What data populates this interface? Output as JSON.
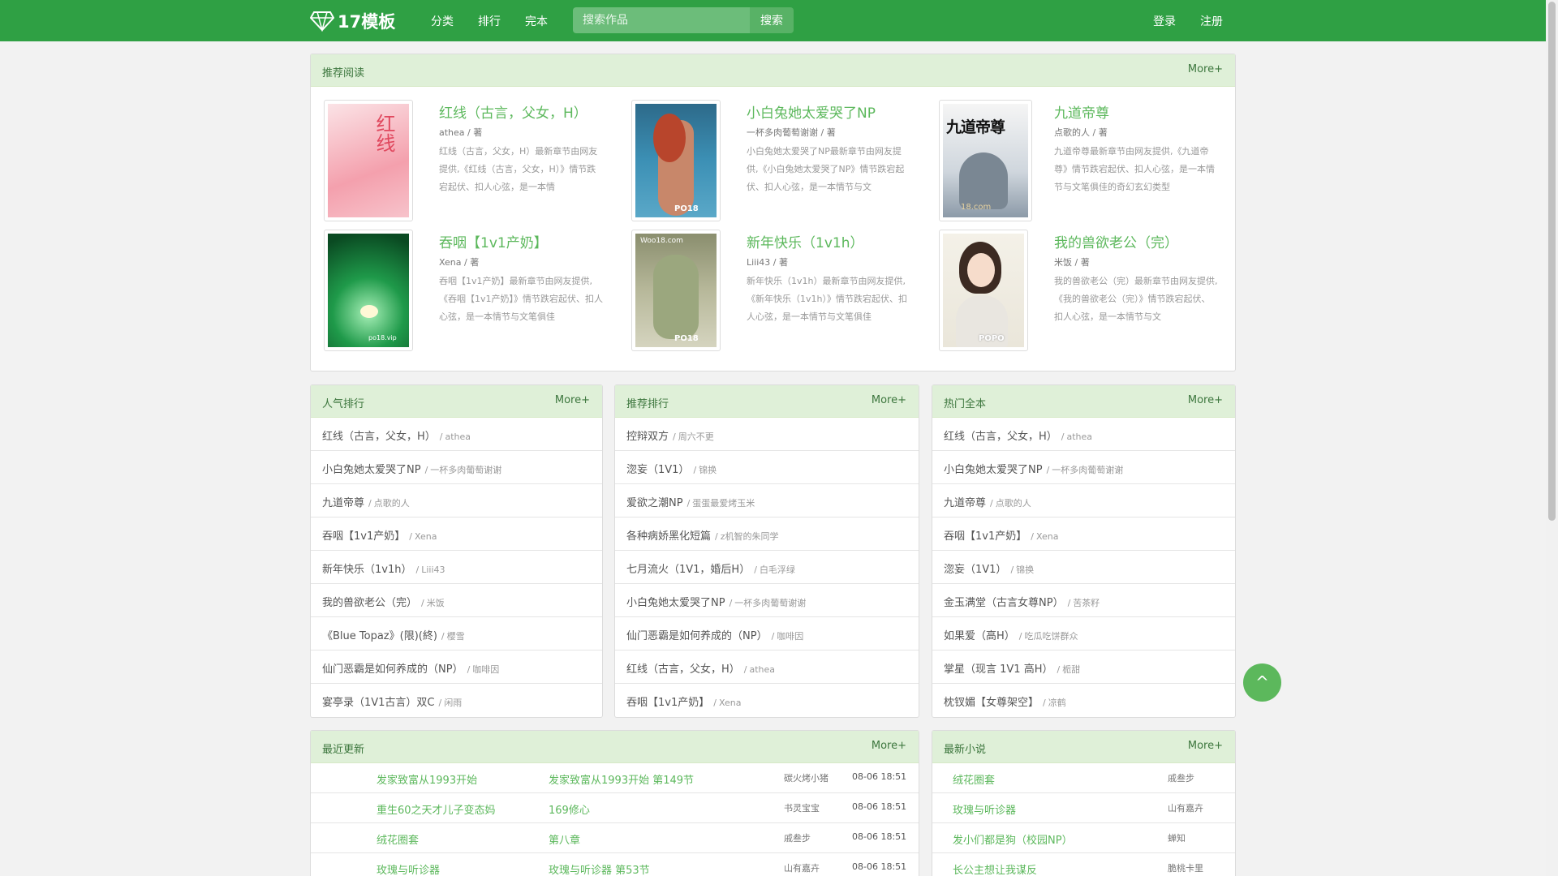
{
  "brand": {
    "name": "17模板"
  },
  "nav": {
    "category": "分类",
    "ranking": "排行",
    "finished": "完本",
    "login": "登录",
    "register": "注册"
  },
  "search": {
    "placeholder": "搜索作品",
    "button": "搜索"
  },
  "recommend": {
    "title": "推荐阅读",
    "more": "More+",
    "books": [
      {
        "title": "红线（古言，父女，H）",
        "author": "athea",
        "author_suffix": "/ 著",
        "desc": "红线（古言，父女，H）最新章节由网友提供,《红线（古言，父女，H）》情节跌宕起伏、扣人心弦，是一本情"
      },
      {
        "title": "小白兔她太爱哭了NP",
        "author": "一杯多肉葡萄谢谢",
        "author_suffix": "/ 著",
        "desc": "小白兔她太爱哭了NP最新章节由网友提供,《小白兔她太爱哭了NP》情节跌宕起伏、扣人心弦，是一本情节与文"
      },
      {
        "title": "九道帝尊",
        "author": "点歌的人",
        "author_suffix": "/ 著",
        "desc": "九道帝尊最新章节由网友提供,《九道帝尊》情节跌宕起伏、扣人心弦，是一本情节与文笔俱佳的奇幻玄幻类型"
      },
      {
        "title": "吞咽【1v1产奶】",
        "author": "Xena",
        "author_suffix": "/ 著",
        "desc": "吞咽【1v1产奶】最新章节由网友提供,《吞咽【1v1产奶】》情节跌宕起伏、扣人心弦，是一本情节与文笔俱佳"
      },
      {
        "title": "新年快乐（1v1h）",
        "author": "Liii43",
        "author_suffix": "/ 著",
        "desc": "新年快乐（1v1h）最新章节由网友提供,《新年快乐（1v1h）》情节跌宕起伏、扣人心弦，是一本情节与文笔俱佳"
      },
      {
        "title": "我的兽欲老公（完）",
        "author": "米饭",
        "author_suffix": "/ 著",
        "desc": "我的兽欲老公（完）最新章节由网友提供,《我的兽欲老公（完）》情节跌宕起伏、扣人心弦，是一本情节与文"
      }
    ],
    "cover_texts": {
      "c0": "红线",
      "c2": "九道帝尊",
      "c3": "po18.vip",
      "c4": "Woo18.com",
      "c4b": "PO18",
      "c1b": "PO18",
      "c5b": "POPO",
      "c2b": "18.com"
    }
  },
  "popular": {
    "title": "人气排行",
    "more": "More+",
    "items": [
      {
        "title": "红线（古言，父女，H）",
        "author": "athea"
      },
      {
        "title": "小白兔她太爱哭了NP",
        "author": "一杯多肉葡萄谢谢"
      },
      {
        "title": "九道帝尊",
        "author": "点歌的人"
      },
      {
        "title": "吞咽【1v1产奶】",
        "author": "Xena"
      },
      {
        "title": "新年快乐（1v1h）",
        "author": "Liii43"
      },
      {
        "title": "我的兽欲老公（完）",
        "author": "米饭"
      },
      {
        "title": "《Blue Topaz》(限)(終)",
        "author": "櫻雪"
      },
      {
        "title": "仙门恶霸是如何养成的（NP）",
        "author": "咖啡因"
      },
      {
        "title": "宴亭录（1V1古言）双C",
        "author": "闲雨"
      }
    ]
  },
  "recrank": {
    "title": "推荐排行",
    "more": "More+",
    "items": [
      {
        "title": "控辩双方",
        "author": "周六不更"
      },
      {
        "title": "淴妄（1V1）",
        "author": "锦换"
      },
      {
        "title": "爱欲之潮NP",
        "author": "蛋蛋最爱烤玉米"
      },
      {
        "title": "各种病娇黑化短篇",
        "author": "z机智的朱同学"
      },
      {
        "title": "七月流火（1V1，婚后H）",
        "author": "白毛浮绿"
      },
      {
        "title": "小白兔她太爱哭了NP",
        "author": "一杯多肉葡萄谢谢"
      },
      {
        "title": "仙门恶霸是如何养成的（NP）",
        "author": "咖啡因"
      },
      {
        "title": "红线（古言，父女，H）",
        "author": "athea"
      },
      {
        "title": "吞咽【1v1产奶】",
        "author": "Xena"
      }
    ]
  },
  "hotfinished": {
    "title": "热门全本",
    "more": "More+",
    "items": [
      {
        "title": "红线（古言，父女，H）",
        "author": "athea"
      },
      {
        "title": "小白兔她太爱哭了NP",
        "author": "一杯多肉葡萄谢谢"
      },
      {
        "title": "九道帝尊",
        "author": "点歌的人"
      },
      {
        "title": "吞咽【1v1产奶】",
        "author": "Xena"
      },
      {
        "title": "淴妄（1V1）",
        "author": "锦换"
      },
      {
        "title": "金玉满堂（古言女尊NP）",
        "author": "苦茶籽"
      },
      {
        "title": "如果爱（高H）",
        "author": "吃瓜吃饼群众"
      },
      {
        "title": "掌星（现言 1V1 高H）",
        "author": "栀甜"
      },
      {
        "title": "枕钗媚【女尊架空】",
        "author": "凉鹤"
      }
    ]
  },
  "recent": {
    "title": "最近更新",
    "more": "More+",
    "items": [
      {
        "book": "发家致富从1993开始",
        "chapter": "发家致富从1993开始 第149节",
        "author": "碳火烤小猪",
        "time": "08-06 18:51"
      },
      {
        "book": "重生60之天才儿子变态妈",
        "chapter": "169修心",
        "author": "书灵宝宝",
        "time": "08-06 18:51"
      },
      {
        "book": "绒花圈套",
        "chapter": "第八章",
        "author": "戚叁步",
        "time": "08-06 18:51"
      },
      {
        "book": "玫瑰与听诊器",
        "chapter": "玫瑰与听诊器 第53节",
        "author": "山有嘉卉",
        "time": "08-06 18:51"
      }
    ]
  },
  "newnovels": {
    "title": "最新小说",
    "more": "More+",
    "items": [
      {
        "book": "绒花圈套",
        "author": "戚叁步"
      },
      {
        "book": "玫瑰与听诊器",
        "author": "山有嘉卉"
      },
      {
        "book": "发小们都是狗（校园NP）",
        "author": "蝉知"
      },
      {
        "book": "长公主想让我谋反",
        "author": "脆桃卡里"
      }
    ]
  },
  "back_top": {
    "label": "^"
  },
  "colors": {
    "brand": "#2fa044",
    "accent": "#5cb85c",
    "panel_head": "#dff0d8"
  }
}
